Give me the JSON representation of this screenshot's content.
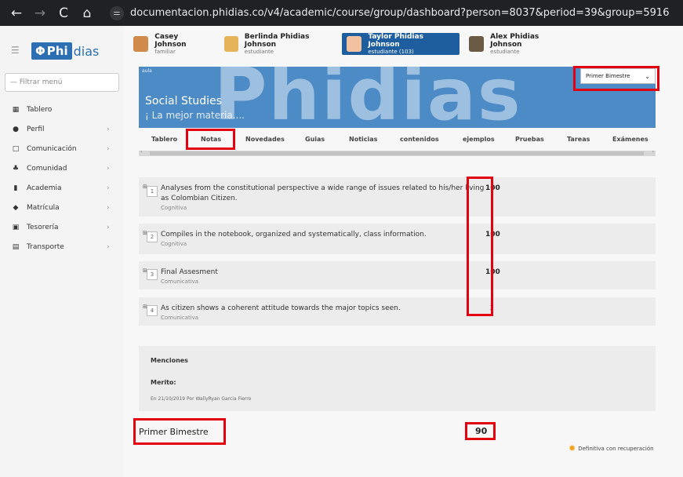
{
  "browser": {
    "back": "←",
    "forward": "→",
    "reload": "C",
    "home": "⌂",
    "site_icon": "⚌",
    "url": "documentacion.phidias.co/v4/academic/course/group/dashboard?person=8037&period=39&group=5916"
  },
  "sidebar": {
    "hamburger": "☰",
    "logo": {
      "mark": "Φ",
      "prefix": "Phi",
      "suffix": "dias"
    },
    "filter_placeholder": "— Filtrar menú",
    "items": [
      {
        "label": "Tablero",
        "icon": "dashboard-icon",
        "glyph": "▦",
        "has_children": false
      },
      {
        "label": "Perfil",
        "icon": "user-icon",
        "glyph": "●",
        "has_children": true
      },
      {
        "label": "Comunicación",
        "icon": "message-icon",
        "glyph": "□",
        "has_children": true
      },
      {
        "label": "Comunidad",
        "icon": "community-icon",
        "glyph": "♣",
        "has_children": true
      },
      {
        "label": "Academia",
        "icon": "book-icon",
        "glyph": "▮",
        "has_children": true
      },
      {
        "label": "Matrícula",
        "icon": "graduation-icon",
        "glyph": "◆",
        "has_children": true
      },
      {
        "label": "Tesorería",
        "icon": "money-icon",
        "glyph": "▣",
        "has_children": true
      },
      {
        "label": "Transporte",
        "icon": "bus-icon",
        "glyph": "▤",
        "has_children": true
      }
    ],
    "chevron": "›"
  },
  "people": [
    {
      "name": "Casey Johnson",
      "role": "familiar",
      "avatar_color": "#d08a4a",
      "active": false
    },
    {
      "name": "Berlinda Phidias Johnson",
      "role": "estudiante",
      "avatar_color": "#e6b35a",
      "active": false
    },
    {
      "name": "Taylor Phidias Johnson",
      "role": "estudiante (103)",
      "avatar_color": "#f2c2a0",
      "active": true
    },
    {
      "name": "Alex Phidias Johnson",
      "role": "estudiante",
      "avatar_color": "#6b5a44",
      "active": false
    }
  ],
  "banner": {
    "tag": "aula",
    "watermark": "Phidias",
    "subject": "Social Studies",
    "motto": "¡ La mejor materia....",
    "period": "Primer Bimestre",
    "period_caret": "⌄"
  },
  "tabs": [
    "Tablero",
    "Notas",
    "Novedades",
    "Guias",
    "Noticias",
    "contenidos",
    "ejemplos",
    "Pruebas",
    "Tareas",
    "Exámenes"
  ],
  "scroll": {
    "left": "‹",
    "right": "›"
  },
  "grades": [
    {
      "index": "1",
      "text": "Analyses from the constitutional perspective a wide range of issues related to his/her living as Colombian Citizen.",
      "category": "Cognitiva",
      "score": "100"
    },
    {
      "index": "2",
      "text": "Compiles in the notebook, organized and systematically, class information.",
      "category": "Cognitiva",
      "score": "100"
    },
    {
      "index": "3",
      "text": "Final Assesment",
      "category": "Comunicativa",
      "score": "100"
    },
    {
      "index": "4",
      "text": "As citizen shows a coherent attitude towards the major topics seen.",
      "category": "Comunicativa",
      "score": "1"
    }
  ],
  "expand_glyph": "⊞",
  "menciones": {
    "title": "Menciones",
    "label": "Merito:",
    "detail": "En 21/10/2019 Por WallyRyan Garcia Fierro"
  },
  "summary": {
    "period_label": "Primer Bimestre",
    "final_score": "90",
    "legend_glyph": "✹",
    "legend": "Definitiva con recuperación"
  },
  "colors": {
    "highlight": "#e3000f",
    "brand": "#2c6fb3",
    "banner": "#4d8bc6",
    "active_person": "#1f5e9e"
  }
}
